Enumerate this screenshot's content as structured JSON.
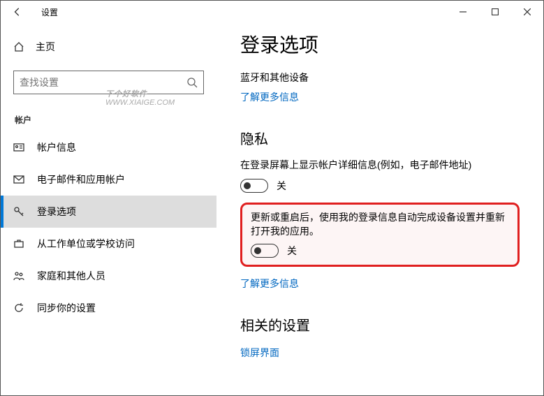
{
  "window": {
    "title": "设置"
  },
  "sidebar": {
    "home": "主页",
    "search_placeholder": "查找设置",
    "category": "帐户",
    "items": [
      {
        "label": "帐户信息"
      },
      {
        "label": "电子邮件和应用帐户"
      },
      {
        "label": "登录选项"
      },
      {
        "label": "从工作单位或学校访问"
      },
      {
        "label": "家庭和其他人员"
      },
      {
        "label": "同步你的设置"
      }
    ]
  },
  "content": {
    "page_title": "登录选项",
    "line1": "蓝牙和其他设备",
    "link1": "了解更多信息",
    "privacy_heading": "隐私",
    "privacy_desc": "在登录屏幕上显示帐户详细信息(例如，电子邮件地址)",
    "toggle1_state": "关",
    "highlight_text": "更新或重启后，使用我的登录信息自动完成设备设置并重新打开我的应用。",
    "toggle2_state": "关",
    "link2": "了解更多信息",
    "related_heading": "相关的设置",
    "related_item": "锁屏界面"
  },
  "watermark": {
    "l1": "下个好软件",
    "l2": "WWW.XIAIGE.COM"
  }
}
